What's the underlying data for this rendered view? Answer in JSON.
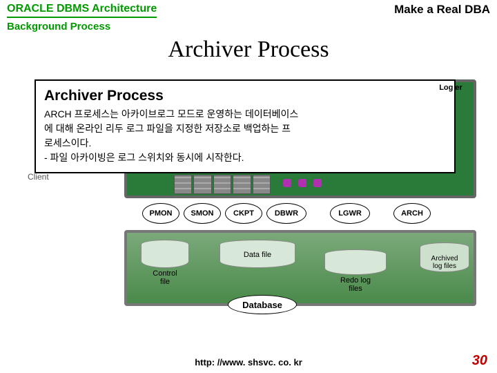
{
  "header": {
    "left": "ORACLE DBMS Architecture",
    "right": "Make a Real DBA",
    "sub": "Background Process"
  },
  "title": "Archiver Process",
  "callout": {
    "title": "Archiver Process",
    "body": "ARCH 프로세스는 아카이브로그 모드로 운영하는 데이터베이스\n에 대해 온라인 리두 로그 파일을 지정한 저장소로 백업하는 프\n로세스이다.\n- 파일 아카이빙은 로그 스위치와 동시에 시작한다."
  },
  "corner_label": "Log er",
  "client_label": "Client",
  "processes": [
    "PMON",
    "SMON",
    "CKPT",
    "DBWR",
    "LGWR",
    "ARCH"
  ],
  "files": {
    "control": "Control\nfile",
    "datafile": "Data file",
    "redo": "Redo log\nfiles",
    "archived": "Archived\nlog files"
  },
  "db_label": "Database",
  "footer": "http: //www. shsvc. co. kr",
  "page": "30"
}
